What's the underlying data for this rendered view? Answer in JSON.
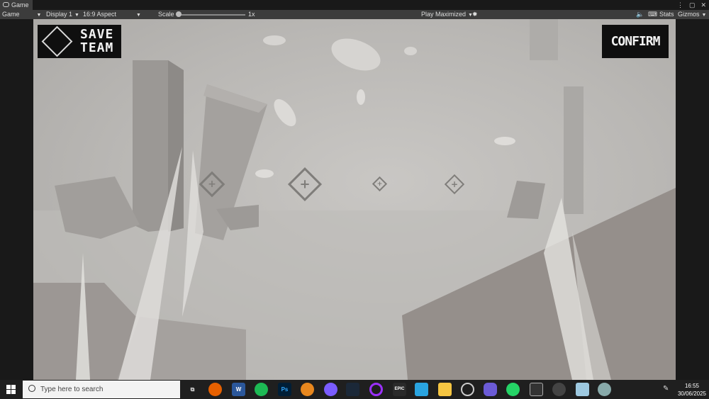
{
  "tab": {
    "label": "Game"
  },
  "window_controls": [
    "⋮",
    "▢",
    "✕"
  ],
  "toolbar": {
    "view_mode": "Game",
    "display": "Display 1",
    "aspect": "16:9 Aspect",
    "scale_label": "Scale",
    "scale_value": "1x",
    "play_mode": "Play Maximized",
    "stats": "Stats",
    "gizmos": "Gizmos"
  },
  "game": {
    "save_team_line1": "SAVE",
    "save_team_line2": "TEAM",
    "confirm": "CONFIRM"
  },
  "taskbar": {
    "search_placeholder": "Type here to search",
    "apps": [
      "task-view",
      "firefox",
      "word",
      "spotify",
      "photoshop",
      "app-orange",
      "app-purple",
      "steam",
      "app-ring",
      "epic-games",
      "app-blue",
      "file-explorer",
      "app-gray",
      "app-controller",
      "whatsapp",
      "unity",
      "app-skull",
      "app-cube",
      "app-gamepad"
    ],
    "time": "16:55",
    "date": "30/06/2025"
  }
}
